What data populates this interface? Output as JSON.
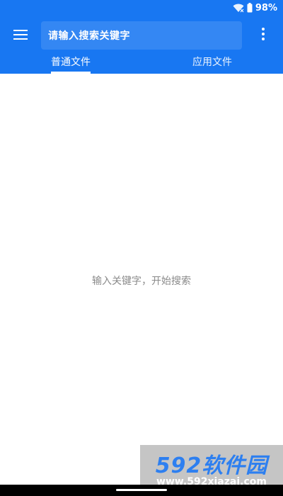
{
  "status_bar": {
    "battery": "98%",
    "wifi_icon": "wifi-no-internet-icon",
    "battery_icon": "battery-icon"
  },
  "toolbar": {
    "menu_icon": "hamburger-menu-icon",
    "search_placeholder": "请输入搜索关键字",
    "overflow_icon": "more-vertical-icon"
  },
  "tabs": [
    {
      "label": "普通文件",
      "selected": true
    },
    {
      "label": "应用文件",
      "selected": false
    }
  ],
  "content": {
    "empty_hint": "输入关键字，开始搜索"
  },
  "watermark": {
    "logo": "592软件园",
    "url": "www.592xiazai.com"
  },
  "colors": {
    "primary": "#1877f2",
    "text_on_primary": "#ffffff",
    "hint_text": "#8a8a8a"
  }
}
